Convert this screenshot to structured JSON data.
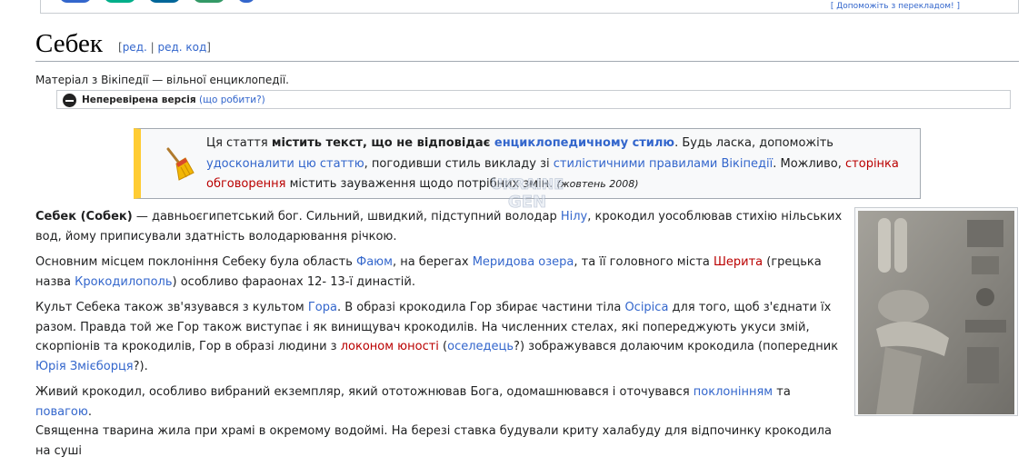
{
  "banner": {
    "help_link": "[ Допоможіть з перекладом! ]"
  },
  "header": {
    "title": "Себек",
    "edit_open": "[",
    "edit": "ред.",
    "sep": " | ",
    "edit_code": "ред. код",
    "edit_close": "]",
    "site_sub": "Матеріал з Вікіпедії — вільної енциклопедії."
  },
  "unreviewed": {
    "label": "Неперевірена версія",
    "help": "(що робити?)"
  },
  "ambox": {
    "t1": "Ця стаття ",
    "t2": "містить текст, що не відповідає ",
    "t3": "енциклопедичному стилю",
    "t4": ". Будь ласка, допоможіть ",
    "t5": "удосконалити цю статтю",
    "t6": ", погодивши стиль викладу зі ",
    "t7": "стилістичними правилами Вікіпедії",
    "t8": ". Можливо, ",
    "t9": "сторінка обговорення",
    "t10": " містить зауваження щодо потрібних змін. ",
    "date": "(жовтень 2008)"
  },
  "watermark": {
    "line1": "UKRAINE",
    "line2": "GEN"
  },
  "colors": {
    "ambox_border": "#ffcc33",
    "link": "#3366cc",
    "redlink": "#ba0000"
  },
  "article": {
    "p1": {
      "bold": "Себек (Собек)",
      "a": " — давньоєгипетський бог. Сильний, швидкий, підступний володар ",
      "l1": "Нілу",
      "b": ", крокодил уособлював стихію нільських вод, йому приписували здатність володарювання річкою."
    },
    "p2": {
      "a": "Основним місцем поклоніння Себеку була область ",
      "l1": "Фаюм",
      "b": ", на берегах ",
      "l2": "Меридова озера",
      "c": ", та її головного міста ",
      "r1": "Шерита",
      "d": " (грецька назва ",
      "l3": "Крокодилополь",
      "e": ") особливо фараонах 12- 13-ї династій."
    },
    "p3": {
      "a": "Культ Себека також зв'язувався з культом ",
      "l1": "Гора",
      "b": ". В образі крокодила Гор збирає частини тіла ",
      "l2": "Осіріса",
      "c": " для того, щоб з'єднати їх разом. Правда той же Гор також виступає і як винищувач крокодилів. На численних стелах, які попереджують укуси змій, скорпіонів та крокодилів, Гор в образі людини з ",
      "r1": "локоном юності",
      "d": " (",
      "l3": "оселедець",
      "e": "?) зображувався долаючим крокодила (попередник ",
      "l4": "Юрія Змієборця",
      "f": "?)."
    },
    "p4": {
      "a": "Живий крокодил, особливо вибраний екземпляр, який ототожнював Бога, одомашнювався і оточувався ",
      "l1": "поклонінням",
      "b": " та ",
      "l2": "повагою",
      "c": ".",
      "line2": "Священна тварина жила при храмі в окремому водоймі. На березі ставка будували криту халабуду для відпочинку крокодила на суші"
    }
  }
}
